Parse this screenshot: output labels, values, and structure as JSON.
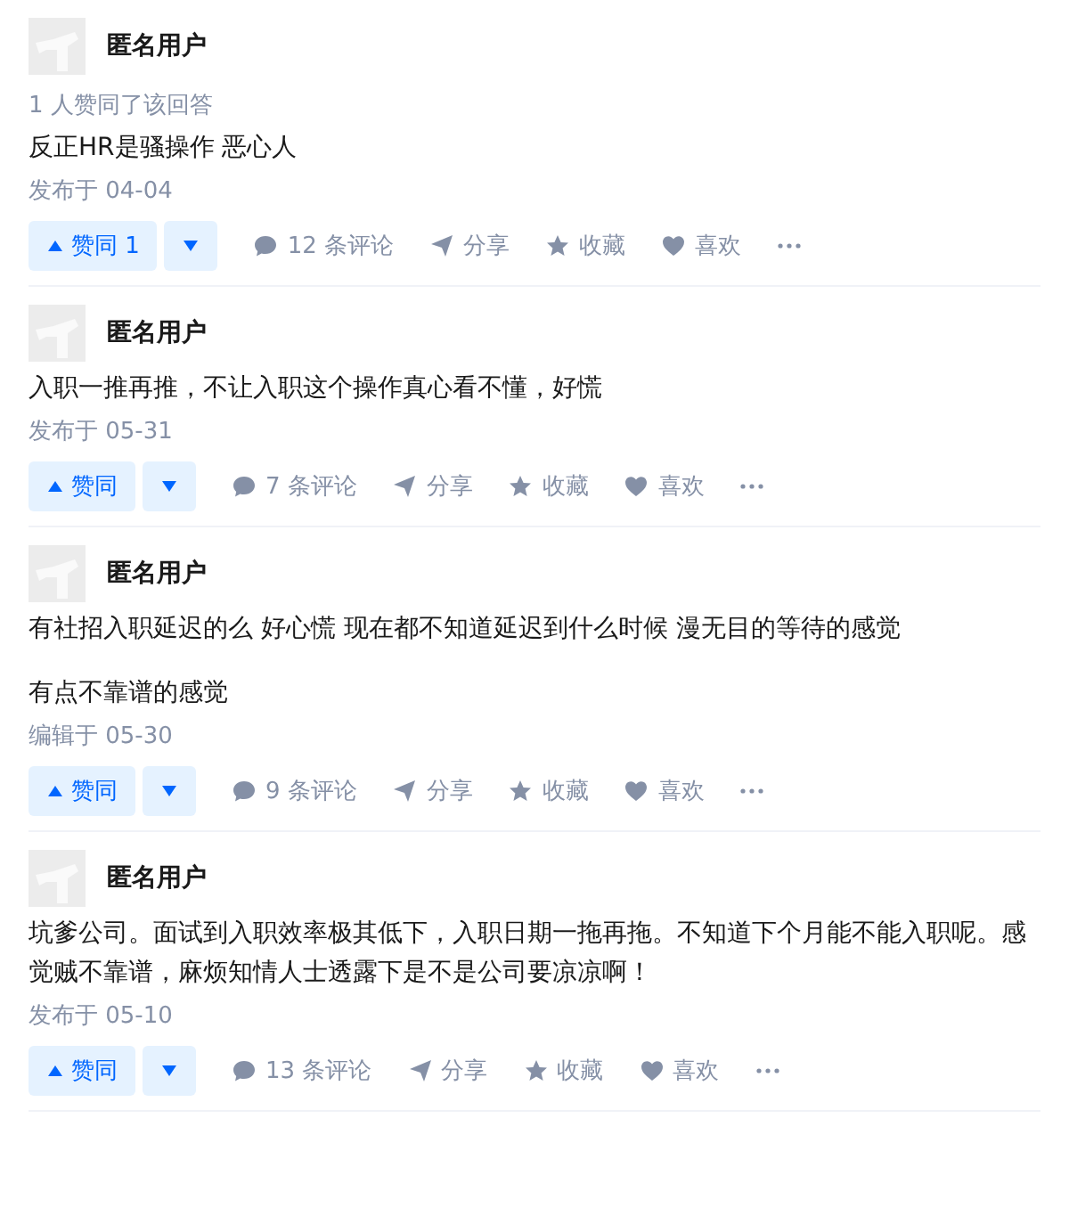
{
  "answers": [
    {
      "author": "匿名用户",
      "vote_summary": "1 人赞同了该回答",
      "paragraphs": [
        "反正HR是骚操作 恶心人"
      ],
      "date": "发布于 04-04",
      "upvote": "赞同 1",
      "comments": "12 条评论",
      "share": "分享",
      "favorite": "收藏",
      "like": "喜欢"
    },
    {
      "author": "匿名用户",
      "paragraphs": [
        "入职一推再推，不让入职这个操作真心看不懂，好慌"
      ],
      "date": "发布于 05-31",
      "upvote": "赞同",
      "comments": "7 条评论",
      "share": "分享",
      "favorite": "收藏",
      "like": "喜欢"
    },
    {
      "author": "匿名用户",
      "paragraphs": [
        "有社招入职延迟的么 好心慌 现在都不知道延迟到什么时候 漫无目的等待的感觉",
        "有点不靠谱的感觉"
      ],
      "date": "编辑于 05-30",
      "upvote": "赞同",
      "comments": "9 条评论",
      "share": "分享",
      "favorite": "收藏",
      "like": "喜欢"
    },
    {
      "author": "匿名用户",
      "paragraphs": [
        "坑爹公司。面试到入职效率极其低下，入职日期一拖再拖。不知道下个月能不能入职呢。感觉贼不靠谱，麻烦知情人士透露下是不是公司要凉凉啊！"
      ],
      "date": "发布于 05-10",
      "upvote": "赞同",
      "comments": "13 条评论",
      "share": "分享",
      "favorite": "收藏",
      "like": "喜欢"
    }
  ]
}
